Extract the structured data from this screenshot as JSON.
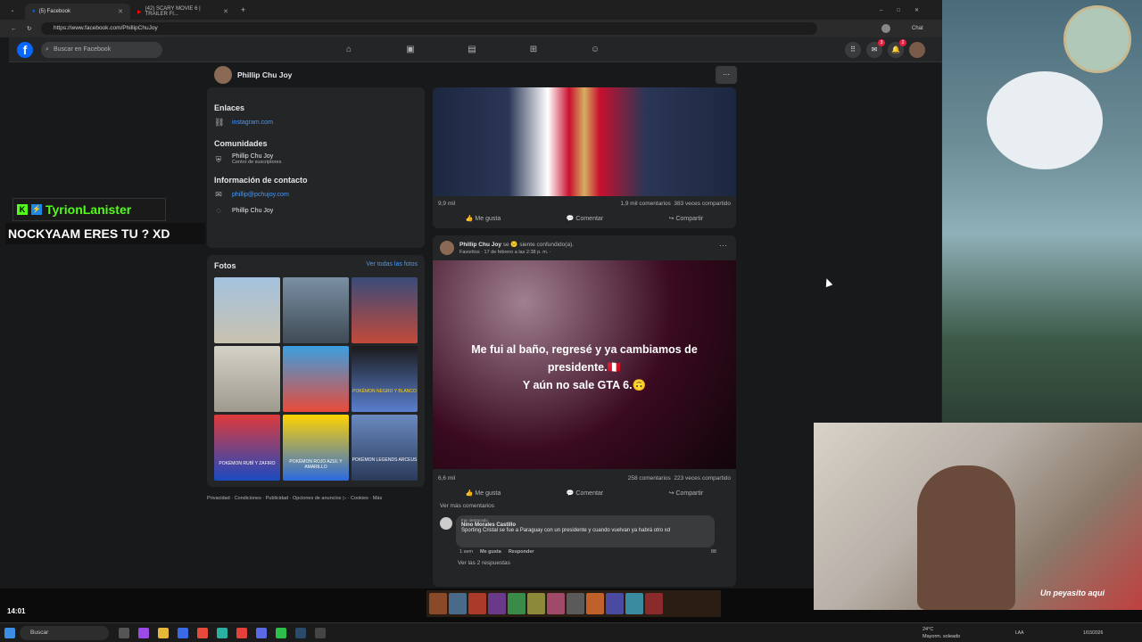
{
  "tabs": [
    {
      "label": "(5) Facebook",
      "active": true
    },
    {
      "label": "(42) SCARY MOVIE 6 | TRAILER FI...",
      "active": false
    }
  ],
  "address": {
    "url": "https://www.facebook.com/PhillipChuJoy"
  },
  "browser": {
    "chat_label": "Chat"
  },
  "fb": {
    "logo": "f",
    "search_placeholder": "Buscar en Facebook",
    "messenger_badge": "3",
    "notif_badge": "2",
    "profile_name": "Phillip Chu Joy",
    "more": "···"
  },
  "about": {
    "links_title": "Enlaces",
    "link": "instagram.com",
    "communities_title": "Comunidades",
    "community_name": "Phillip Chu Joy",
    "community_sub": "Centro de suscriptores",
    "contact_title": "Información de contacto",
    "contact_email": "phillip@pchujoy.com",
    "contact_name": "Phillip Chu Joy"
  },
  "photos": {
    "title": "Fotos",
    "see_all": "Ver todas las fotos",
    "captions": [
      "",
      "",
      "",
      "",
      "POKÉMON NEGRO Y BLANCO",
      "",
      "POKÉMON RUBÍ Y ZAFIRO",
      "POKÉMON ROJO AZUL Y AMARILLO",
      "POKÉMON LEGENDS ARCEUS"
    ]
  },
  "footer": "Privacidad · Condiciones · Publicidad · Opciones de anuncios ▷ · Cookies · Más",
  "post1": {
    "reactions": "9,9 mil",
    "comments": "1,9 mil comentarios",
    "shares": "383 veces compartido",
    "like": "Me gusta",
    "comment": "Comentar",
    "share": "Compartir"
  },
  "post2": {
    "author": "Phillip Chu Joy",
    "feeling": "se 😕 siente confundido(a).",
    "meta": "Favoritos · 17 de febrero a las 2:38 p. m. ·",
    "text_line1": "Me fui al baño, regresé y ya cambiamos de",
    "text_line2": "presidente.🇵🇪",
    "text_line3": "Y aún no sale GTA 6.🙃",
    "reactions": "6,6 mil",
    "comments": "258 comentarios",
    "shares": "223 veces compartido",
    "like": "Me gusta",
    "comment": "Comentar",
    "share": "Compartir",
    "more_comments": "Ver más comentarios"
  },
  "comment": {
    "badge": "Fan destacado",
    "name": "Nino Morales Castillo",
    "text": "Sporting Cristal se fue a Paraguay con un presidente y cuando vuelvan ya habrá otro xd",
    "time": "1 sem",
    "like": "Me gusta",
    "reply": "Responder",
    "count": "88",
    "replies": "Ver las 2 respuestas"
  },
  "overlay": {
    "name": "TyrionLanister",
    "message": "NOCKYAAM ERES TU ? XD"
  },
  "stream": {
    "clock": "14:01",
    "cam_label": "Un peyasito aqui"
  },
  "taskbar": {
    "search": "Buscar",
    "weather_temp": "24°C",
    "weather_desc": "Mayorm. soleado",
    "lang": "LAA",
    "date": "1/03/2026"
  },
  "colors": {
    "fb_blue": "#0866ff",
    "bg": "#18191a",
    "card": "#242526"
  }
}
